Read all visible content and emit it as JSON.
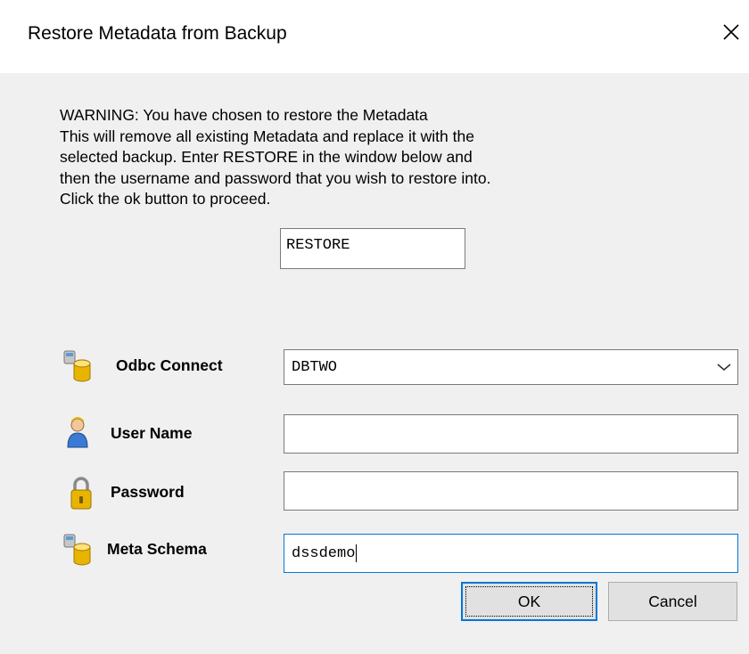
{
  "window": {
    "title": "Restore Metadata from Backup",
    "close_icon": "close-icon"
  },
  "warning": {
    "lines": [
      "WARNING: You have chosen to restore the Metadata",
      "This will remove all existing Metadata and replace it with the",
      "selected backup. Enter RESTORE in the window below and",
      "then the username and password that you wish to restore into.",
      "Click the ok button to proceed."
    ]
  },
  "restore_input": {
    "value": "RESTORE"
  },
  "fields": {
    "odbc": {
      "label": "Odbc Connect",
      "value": "DBTWO",
      "icon": "database-icon"
    },
    "user": {
      "label": "User Name",
      "value": "",
      "icon": "user-icon"
    },
    "password": {
      "label": "Password",
      "value": "",
      "icon": "lock-icon"
    },
    "schema": {
      "label": "Meta Schema",
      "value": "dssdemo",
      "icon": "database-icon"
    }
  },
  "buttons": {
    "ok": "OK",
    "cancel": "Cancel"
  },
  "colors": {
    "dialog_bg": "#f0f0f0",
    "focus_border": "#0078d7",
    "icon_gold": "#e8b400"
  }
}
